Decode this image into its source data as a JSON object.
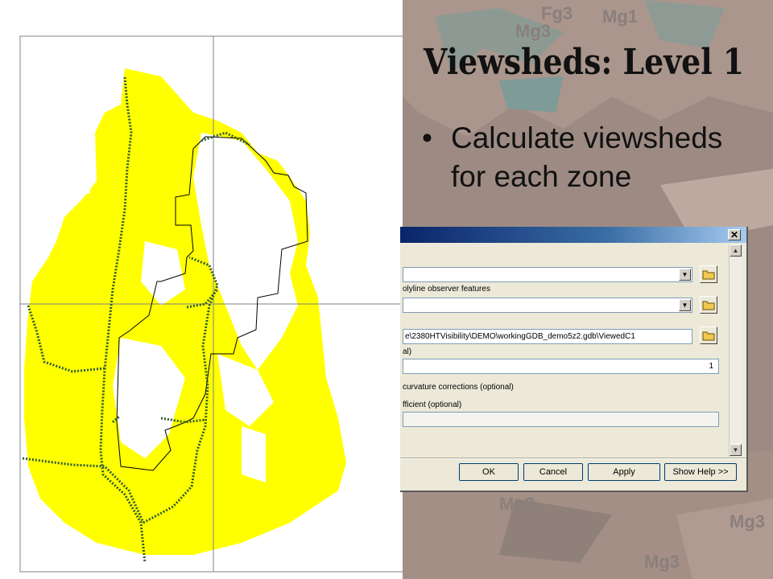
{
  "slide": {
    "title": "Viewsheds: Level 1",
    "bullet": "Calculate viewsheds for each zone",
    "bullet_marker": "•"
  },
  "background_map": {
    "labels": [
      "Fg3",
      "Mg1",
      "Mg3",
      "Mg3",
      "Mg3",
      "Mg3"
    ]
  },
  "map": {
    "fill_color": "#ffff00",
    "route_color": "#2d5a2d",
    "grid_color": "#808080"
  },
  "dialog": {
    "close_glyph": "✕",
    "fields": {
      "input_raster": "",
      "observer_label": "olyline observer features",
      "observer_value": "",
      "output_raster": "e\\2380HTVisibility\\DEMO\\workingGDB_demo5z2.gdb\\ViewedC1",
      "z_factor_label": "al)",
      "z_factor_value": "1",
      "curvature_label": "curvature corrections (optional)",
      "refraction_label": "fficient (optional)",
      "refraction_value": ""
    },
    "buttons": {
      "ok": "OK",
      "cancel": "Cancel",
      "apply": "Apply",
      "help": "Show Help >>"
    },
    "scroll_up": "▲",
    "scroll_down": "▼",
    "dropdown_glyph": "▼"
  }
}
